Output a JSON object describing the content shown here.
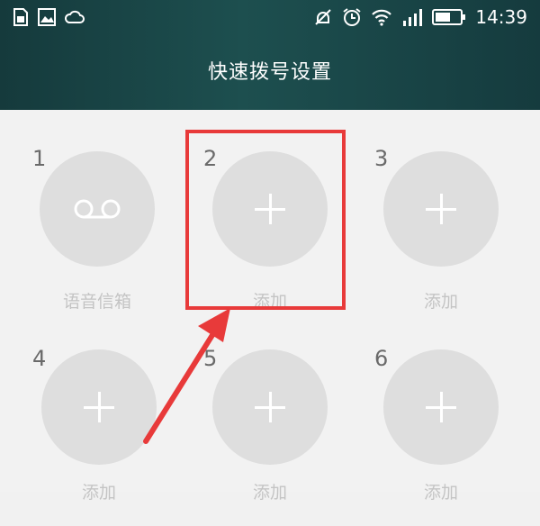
{
  "status_bar": {
    "time": "14:39",
    "left_icons": [
      "sim-icon",
      "image-icon",
      "cloud-icon"
    ],
    "right_icons": [
      "mute-icon",
      "alarm-icon",
      "wifi-icon",
      "signal-icon",
      "battery-icon"
    ]
  },
  "header": {
    "title": "快速拨号设置"
  },
  "slots": [
    {
      "number": "1",
      "label": "语音信箱",
      "icon": "voicemail-icon"
    },
    {
      "number": "2",
      "label": "添加",
      "icon": "plus-icon"
    },
    {
      "number": "3",
      "label": "添加",
      "icon": "plus-icon"
    },
    {
      "number": "4",
      "label": "添加",
      "icon": "plus-icon"
    },
    {
      "number": "5",
      "label": "添加",
      "icon": "plus-icon"
    },
    {
      "number": "6",
      "label": "添加",
      "icon": "plus-icon"
    }
  ],
  "annotation": {
    "highlight_color": "#e83a3a",
    "highlighted_slot": "2"
  },
  "colors": {
    "header_bg": "#1d4f4f",
    "circle_bg": "#dedede",
    "label_color": "#c4c4c4"
  }
}
